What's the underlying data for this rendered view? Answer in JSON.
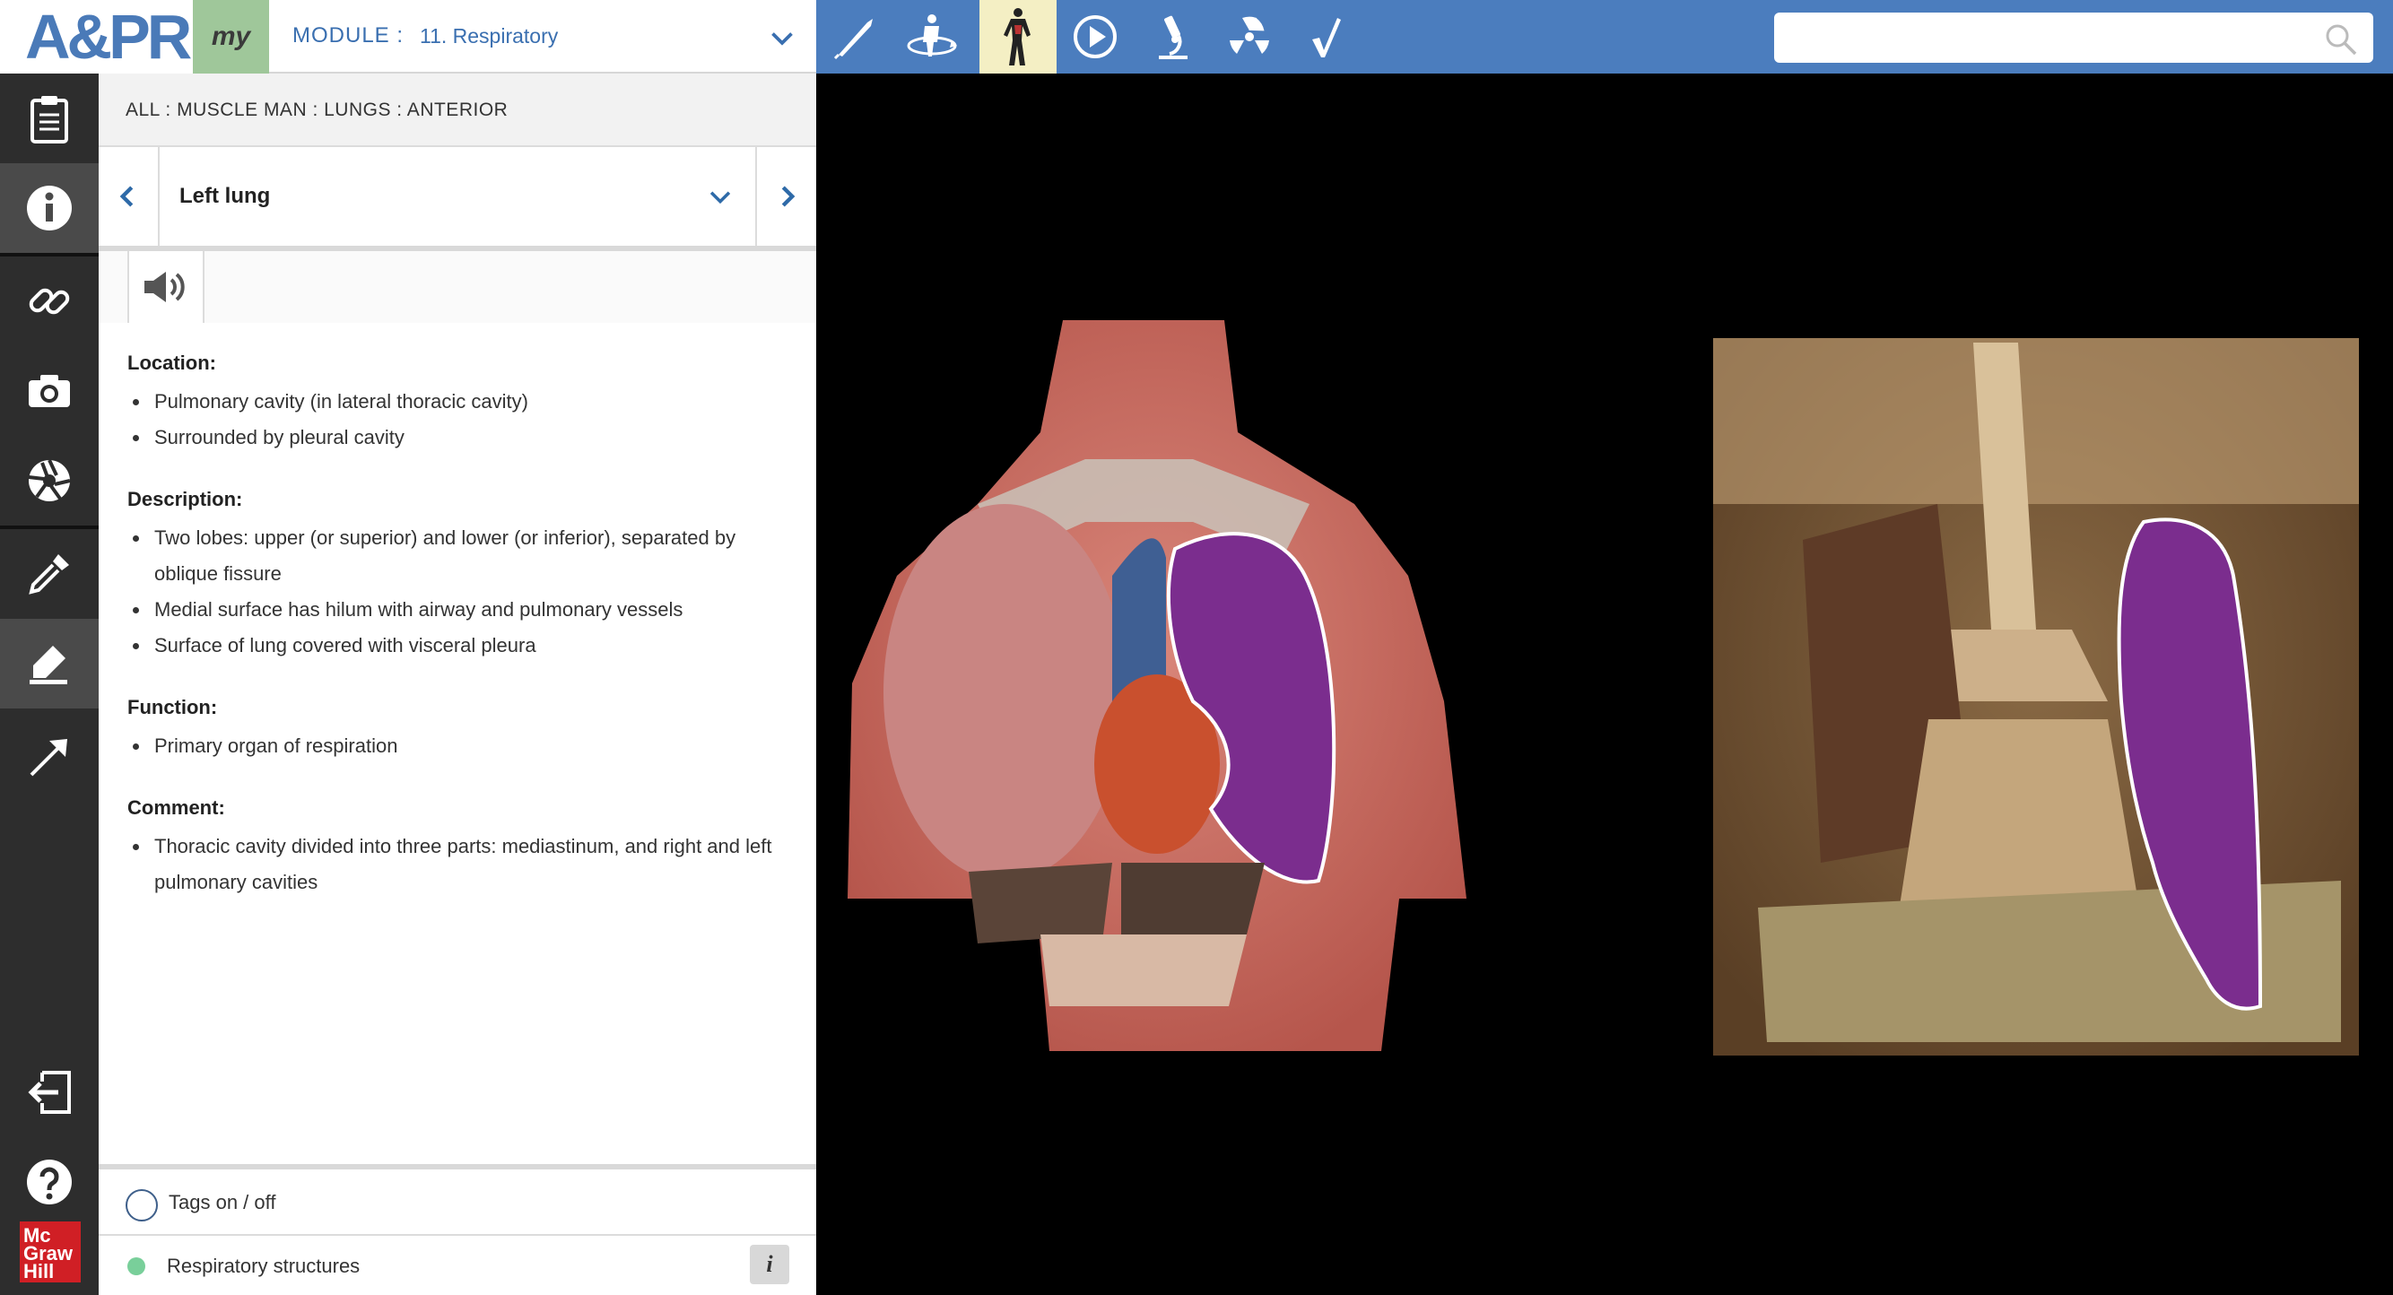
{
  "header": {
    "logo_text": "A&PR",
    "my_label": "my",
    "module_label": "MODULE :",
    "module_value": "11. Respiratory"
  },
  "toolbar": {
    "tools": [
      "dissect-icon",
      "rotate-body-icon",
      "muscle-man-icon",
      "play-icon",
      "microscope-icon",
      "radiation-icon",
      "quiz-check-icon"
    ],
    "active_tool": "muscle-man-icon",
    "search_placeholder": ""
  },
  "rail": {
    "items": [
      "clipboard-icon",
      "info-icon",
      "link-icon",
      "camera-icon",
      "aperture-icon",
      "dropper-icon",
      "highlighter-icon",
      "arrow-icon",
      "exit-icon",
      "help-icon"
    ],
    "active_items": [
      "info-icon",
      "highlighter-icon"
    ],
    "brand_text": "Mc Graw Hill"
  },
  "panel": {
    "breadcrumb": "ALL : MUSCLE MAN : LUNGS : ANTERIOR",
    "structure_name": "Left lung",
    "sections": [
      {
        "heading": "Location:",
        "items": [
          "Pulmonary cavity (in lateral thoracic cavity)",
          "Surrounded by pleural cavity"
        ]
      },
      {
        "heading": "Description:",
        "items": [
          "Two lobes: upper (or superior) and lower (or inferior), separated by oblique fissure",
          "Medial surface has hilum with airway and pulmonary vessels",
          "Surface of lung covered with visceral pleura"
        ]
      },
      {
        "heading": "Function:",
        "items": [
          "Primary organ of respiration"
        ]
      },
      {
        "heading": "Comment:",
        "items": [
          "Thoracic cavity divided into three parts: mediastinum, and right and left pulmonary cavities"
        ]
      }
    ],
    "tags_label": "Tags on / off",
    "legend_label": "Respiratory structures",
    "legend_color": "#79cf9a"
  },
  "viewer": {
    "highlight_color": "#7b2d8e"
  }
}
